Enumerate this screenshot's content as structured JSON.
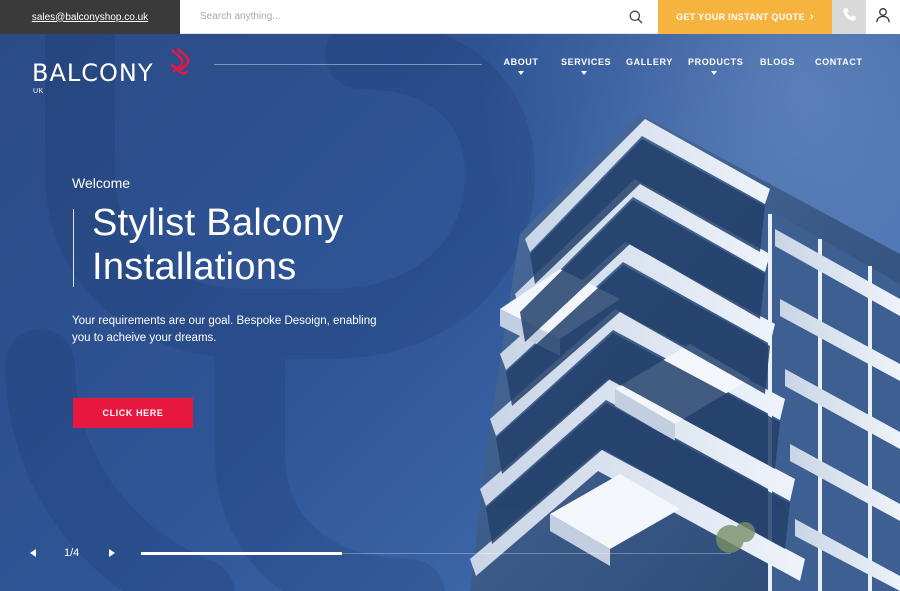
{
  "topbar": {
    "email": "sales@balconyshop.co.uk",
    "search_placeholder": "Search anything...",
    "quote_label": "GET YOUR INSTANT QUOTE",
    "quote_suffix": "›"
  },
  "brand": {
    "name": "BALCONY",
    "sub": "UK",
    "accent_color": "#e8173f"
  },
  "nav": {
    "items": [
      {
        "label": "ABOUT",
        "has_dropdown": true
      },
      {
        "label": "SERVICES",
        "has_dropdown": true
      },
      {
        "label": "GALLERY",
        "has_dropdown": false
      },
      {
        "label": "PRODUCTS",
        "has_dropdown": true
      },
      {
        "label": "BLOGS",
        "has_dropdown": false
      },
      {
        "label": "CONTACT",
        "has_dropdown": false
      }
    ]
  },
  "hero": {
    "welcome": "Welcome",
    "title_line1": "Stylist Balcony",
    "title_line2": "Installations",
    "subtitle": "Your requirements are our goal. Bespoke Desoign, enabling you to acheive your dreams.",
    "cta_label": "CLICK HERE"
  },
  "slider": {
    "counter": "1/4",
    "progress": 0.34
  },
  "colors": {
    "quote_bg": "#f6b33d",
    "cta_bg": "#e8173f",
    "hero_bg": "#2f5597"
  },
  "icons": [
    "search-icon",
    "phone-icon",
    "user-icon",
    "prev-arrow-icon",
    "next-arrow-icon",
    "chevron-down-icon"
  ]
}
